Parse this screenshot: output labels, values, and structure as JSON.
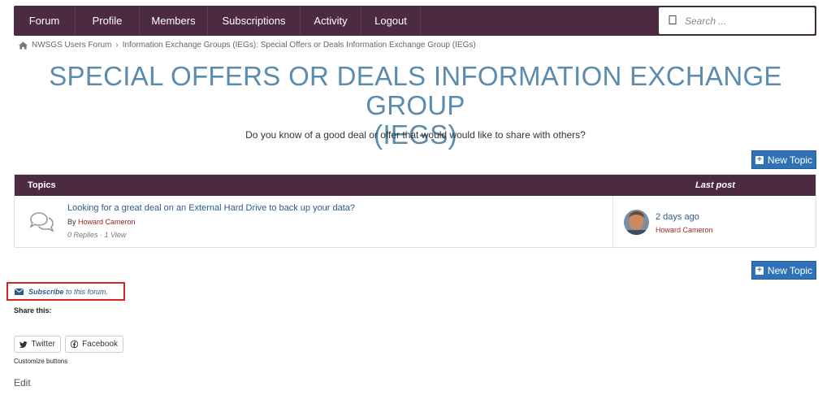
{
  "nav": {
    "items": [
      {
        "label": "Forum"
      },
      {
        "label": "Profile"
      },
      {
        "label": "Members"
      },
      {
        "label": "Subscriptions"
      },
      {
        "label": "Activity"
      },
      {
        "label": "Logout"
      }
    ],
    "search_placeholder": "Search ...",
    "search_icon": "search-icon",
    "background": "#4b2a42"
  },
  "breadcrumb": {
    "home": "NWSGS Users Forum",
    "current": "Information Exchange Groups (IEGs): Special Offers or Deals Information Exchange Group (IEGs)"
  },
  "page": {
    "title_line1": "SPECIAL OFFERS OR DEALS INFORMATION EXCHANGE GROUP",
    "title_line2": "(IEGS)",
    "description": "Do you know of a good deal or offer that would would like to share with others?",
    "title_color": "#5b8cae"
  },
  "actions": {
    "new_topic": "New Topic",
    "accent": "#2f72b8"
  },
  "table": {
    "col_topics": "Topics",
    "col_last_post": "Last post",
    "rows": [
      {
        "title": "Looking for a great deal on an External Hard Drive to back up your data?",
        "by": "By",
        "author": "Howard Cameron",
        "meta": "0 Replies · 1 View",
        "last_time": "2 days ago",
        "last_author": "Howard Cameron"
      }
    ]
  },
  "subscribe": {
    "link": "Subscribe",
    "rest": "to this forum."
  },
  "share": {
    "label": "Share this:",
    "twitter": "Twitter",
    "facebook": "Facebook",
    "customize": "Customize buttons"
  },
  "footer": {
    "edit": "Edit"
  }
}
